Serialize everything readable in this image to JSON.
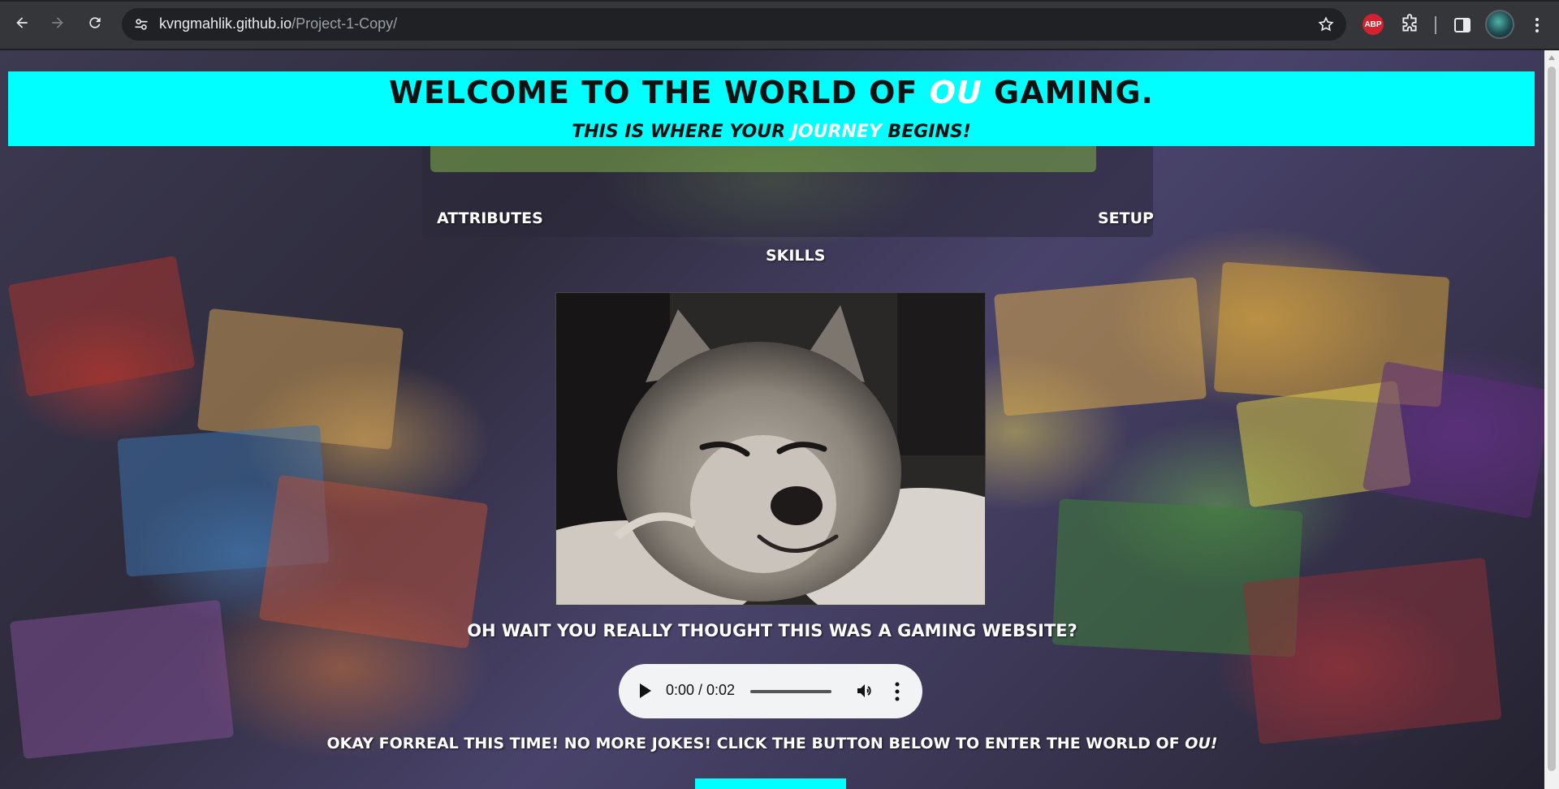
{
  "browser": {
    "url_domain": "kvngmahlik.github.io",
    "url_path": "/Project-1-Copy/",
    "extension_label": "ABP"
  },
  "page": {
    "heading_prefix": "Welcome to the world of ",
    "heading_highlight": "OU",
    "heading_suffix": " gaming.",
    "subheading_prefix": "This is where your ",
    "subheading_highlight": "journey",
    "subheading_suffix": " begins!",
    "nav": {
      "attributes": "Attributes",
      "setup": "Setup",
      "skills": "Skills"
    },
    "prank_text": "Oh wait you really thought this was a gaming website?",
    "audio": {
      "time": "0:00 / 0:02"
    },
    "final_prefix": "Okay forreal this time! No more jokes! Click the button below to enter the world of ",
    "final_highlight": "OU!"
  },
  "colors": {
    "banner": "#00ffff",
    "chrome": "#35363a"
  }
}
